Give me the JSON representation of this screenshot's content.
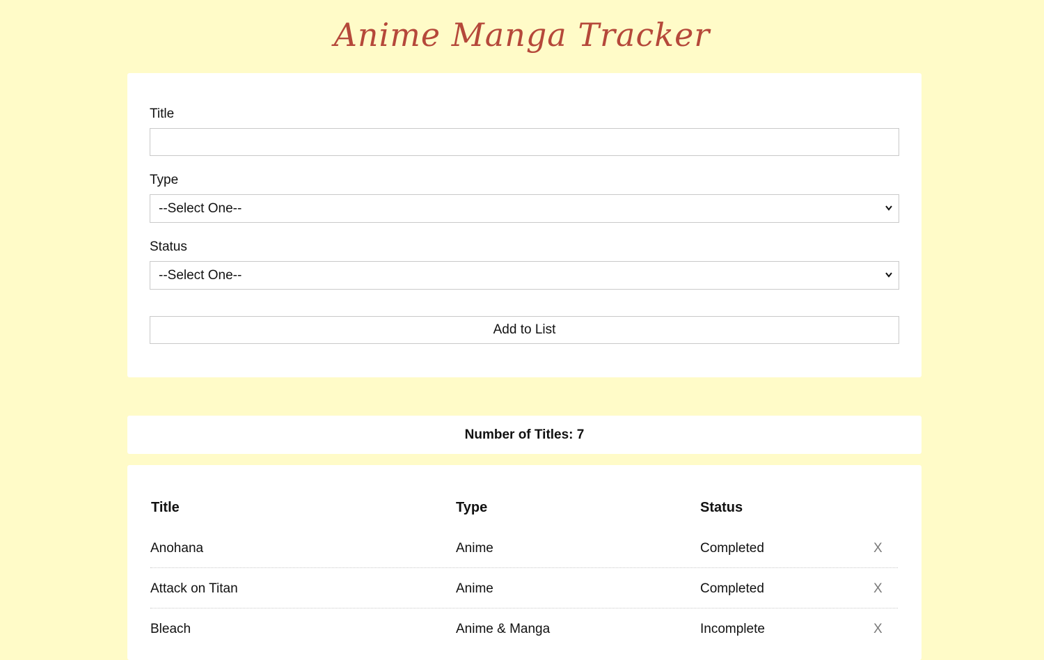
{
  "app": {
    "title": "Anime Manga Tracker"
  },
  "form": {
    "title_label": "Title",
    "title_value": "",
    "type_label": "Type",
    "type_selected": "--Select One--",
    "status_label": "Status",
    "status_selected": "--Select One--",
    "add_button_label": "Add to List"
  },
  "count": {
    "label": "Number of Titles: 7"
  },
  "table": {
    "headers": {
      "title": "Title",
      "type": "Type",
      "status": "Status"
    },
    "rows": [
      {
        "title": "Anohana",
        "type": "Anime",
        "status": "Completed",
        "delete": "X"
      },
      {
        "title": "Attack on Titan",
        "type": "Anime",
        "status": "Completed",
        "delete": "X"
      },
      {
        "title": "Bleach",
        "type": "Anime & Manga",
        "status": "Incomplete",
        "delete": "X"
      }
    ]
  },
  "colors": {
    "background": "#fffbc8",
    "title_accent": "#b5483a",
    "card": "#ffffff"
  }
}
